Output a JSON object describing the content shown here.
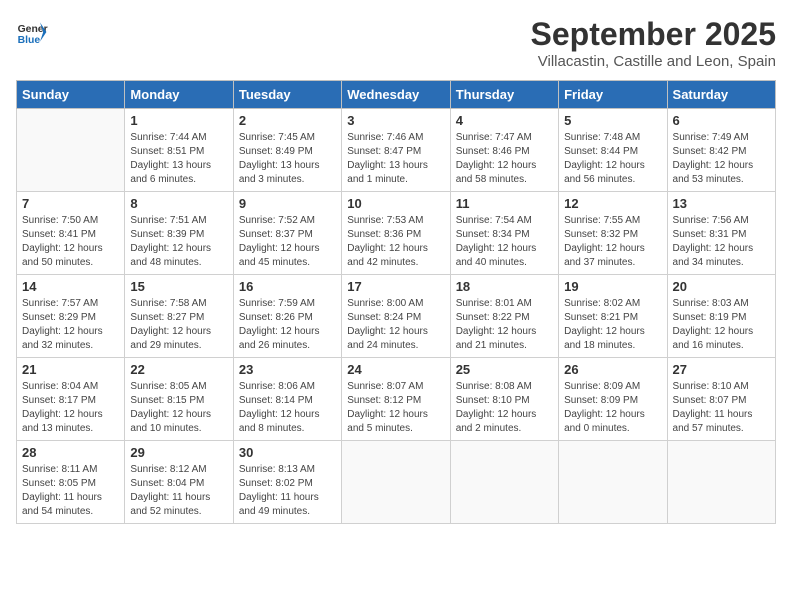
{
  "header": {
    "logo_general": "General",
    "logo_blue": "Blue",
    "month_title": "September 2025",
    "location": "Villacastin, Castille and Leon, Spain"
  },
  "calendar": {
    "days_of_week": [
      "Sunday",
      "Monday",
      "Tuesday",
      "Wednesday",
      "Thursday",
      "Friday",
      "Saturday"
    ],
    "weeks": [
      [
        {
          "day": "",
          "info": ""
        },
        {
          "day": "1",
          "info": "Sunrise: 7:44 AM\nSunset: 8:51 PM\nDaylight: 13 hours\nand 6 minutes."
        },
        {
          "day": "2",
          "info": "Sunrise: 7:45 AM\nSunset: 8:49 PM\nDaylight: 13 hours\nand 3 minutes."
        },
        {
          "day": "3",
          "info": "Sunrise: 7:46 AM\nSunset: 8:47 PM\nDaylight: 13 hours\nand 1 minute."
        },
        {
          "day": "4",
          "info": "Sunrise: 7:47 AM\nSunset: 8:46 PM\nDaylight: 12 hours\nand 58 minutes."
        },
        {
          "day": "5",
          "info": "Sunrise: 7:48 AM\nSunset: 8:44 PM\nDaylight: 12 hours\nand 56 minutes."
        },
        {
          "day": "6",
          "info": "Sunrise: 7:49 AM\nSunset: 8:42 PM\nDaylight: 12 hours\nand 53 minutes."
        }
      ],
      [
        {
          "day": "7",
          "info": "Sunrise: 7:50 AM\nSunset: 8:41 PM\nDaylight: 12 hours\nand 50 minutes."
        },
        {
          "day": "8",
          "info": "Sunrise: 7:51 AM\nSunset: 8:39 PM\nDaylight: 12 hours\nand 48 minutes."
        },
        {
          "day": "9",
          "info": "Sunrise: 7:52 AM\nSunset: 8:37 PM\nDaylight: 12 hours\nand 45 minutes."
        },
        {
          "day": "10",
          "info": "Sunrise: 7:53 AM\nSunset: 8:36 PM\nDaylight: 12 hours\nand 42 minutes."
        },
        {
          "day": "11",
          "info": "Sunrise: 7:54 AM\nSunset: 8:34 PM\nDaylight: 12 hours\nand 40 minutes."
        },
        {
          "day": "12",
          "info": "Sunrise: 7:55 AM\nSunset: 8:32 PM\nDaylight: 12 hours\nand 37 minutes."
        },
        {
          "day": "13",
          "info": "Sunrise: 7:56 AM\nSunset: 8:31 PM\nDaylight: 12 hours\nand 34 minutes."
        }
      ],
      [
        {
          "day": "14",
          "info": "Sunrise: 7:57 AM\nSunset: 8:29 PM\nDaylight: 12 hours\nand 32 minutes."
        },
        {
          "day": "15",
          "info": "Sunrise: 7:58 AM\nSunset: 8:27 PM\nDaylight: 12 hours\nand 29 minutes."
        },
        {
          "day": "16",
          "info": "Sunrise: 7:59 AM\nSunset: 8:26 PM\nDaylight: 12 hours\nand 26 minutes."
        },
        {
          "day": "17",
          "info": "Sunrise: 8:00 AM\nSunset: 8:24 PM\nDaylight: 12 hours\nand 24 minutes."
        },
        {
          "day": "18",
          "info": "Sunrise: 8:01 AM\nSunset: 8:22 PM\nDaylight: 12 hours\nand 21 minutes."
        },
        {
          "day": "19",
          "info": "Sunrise: 8:02 AM\nSunset: 8:21 PM\nDaylight: 12 hours\nand 18 minutes."
        },
        {
          "day": "20",
          "info": "Sunrise: 8:03 AM\nSunset: 8:19 PM\nDaylight: 12 hours\nand 16 minutes."
        }
      ],
      [
        {
          "day": "21",
          "info": "Sunrise: 8:04 AM\nSunset: 8:17 PM\nDaylight: 12 hours\nand 13 minutes."
        },
        {
          "day": "22",
          "info": "Sunrise: 8:05 AM\nSunset: 8:15 PM\nDaylight: 12 hours\nand 10 minutes."
        },
        {
          "day": "23",
          "info": "Sunrise: 8:06 AM\nSunset: 8:14 PM\nDaylight: 12 hours\nand 8 minutes."
        },
        {
          "day": "24",
          "info": "Sunrise: 8:07 AM\nSunset: 8:12 PM\nDaylight: 12 hours\nand 5 minutes."
        },
        {
          "day": "25",
          "info": "Sunrise: 8:08 AM\nSunset: 8:10 PM\nDaylight: 12 hours\nand 2 minutes."
        },
        {
          "day": "26",
          "info": "Sunrise: 8:09 AM\nSunset: 8:09 PM\nDaylight: 12 hours\nand 0 minutes."
        },
        {
          "day": "27",
          "info": "Sunrise: 8:10 AM\nSunset: 8:07 PM\nDaylight: 11 hours\nand 57 minutes."
        }
      ],
      [
        {
          "day": "28",
          "info": "Sunrise: 8:11 AM\nSunset: 8:05 PM\nDaylight: 11 hours\nand 54 minutes."
        },
        {
          "day": "29",
          "info": "Sunrise: 8:12 AM\nSunset: 8:04 PM\nDaylight: 11 hours\nand 52 minutes."
        },
        {
          "day": "30",
          "info": "Sunrise: 8:13 AM\nSunset: 8:02 PM\nDaylight: 11 hours\nand 49 minutes."
        },
        {
          "day": "",
          "info": ""
        },
        {
          "day": "",
          "info": ""
        },
        {
          "day": "",
          "info": ""
        },
        {
          "day": "",
          "info": ""
        }
      ]
    ]
  }
}
